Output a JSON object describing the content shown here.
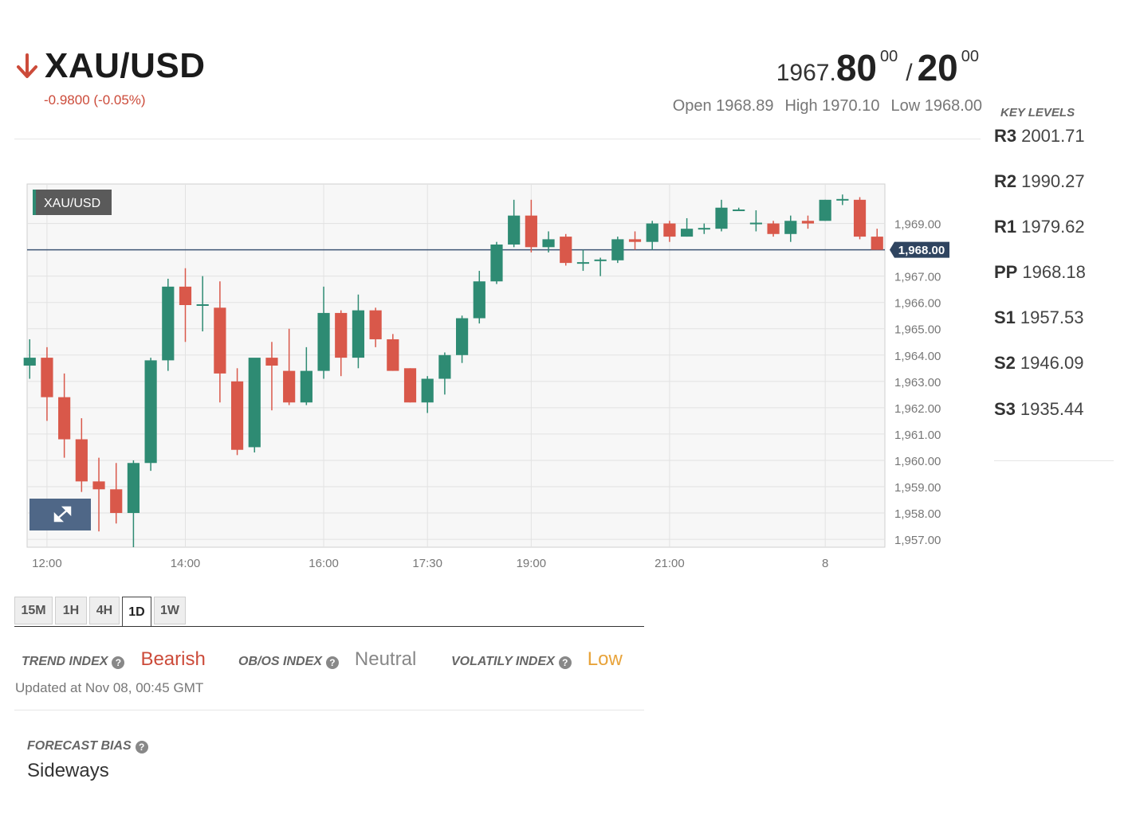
{
  "header": {
    "symbol": "XAU/USD",
    "change": "-0.9800 (-0.05%)",
    "bid_int": "1967.",
    "bid_big": "80",
    "bid_sup": "00",
    "sep": "/",
    "ask_big": "20",
    "ask_sup": "00",
    "open": "Open 1968.89",
    "high": "High 1970.10",
    "low": "Low 1968.00",
    "colors": {
      "down": "#cc4b3a",
      "up": "#2e8b73"
    }
  },
  "key_levels": {
    "title": "KEY LEVELS",
    "items": [
      {
        "name": "R3",
        "value": "2001.71"
      },
      {
        "name": "R2",
        "value": "1990.27"
      },
      {
        "name": "R1",
        "value": "1979.62"
      },
      {
        "name": "PP",
        "value": "1968.18"
      },
      {
        "name": "S1",
        "value": "1957.53"
      },
      {
        "name": "S2",
        "value": "1946.09"
      },
      {
        "name": "S3",
        "value": "1935.44"
      }
    ]
  },
  "chart_data": {
    "type": "candlestick",
    "legend_label": "XAU/USD",
    "current_price": 1968.0,
    "current_price_label": "1,968.00",
    "ylim": [
      1956.7,
      1970.5
    ],
    "y_ticks": [
      1969,
      1967,
      1966,
      1965,
      1964,
      1963,
      1962,
      1961,
      1960,
      1959,
      1958,
      1957
    ],
    "y_tick_labels": [
      "1,969.00",
      "1,967.00",
      "1,966.00",
      "1,965.00",
      "1,964.00",
      "1,963.00",
      "1,962.00",
      "1,961.00",
      "1,960.00",
      "1,959.00",
      "1,958.00",
      "1,957.00"
    ],
    "x_ticks": [
      {
        "index": 1,
        "label": "12:00"
      },
      {
        "index": 9,
        "label": "14:00"
      },
      {
        "index": 17,
        "label": "16:00"
      },
      {
        "index": 23,
        "label": "17:30"
      },
      {
        "index": 29,
        "label": "19:00"
      },
      {
        "index": 37,
        "label": "21:00"
      },
      {
        "index": 46,
        "label": "8"
      }
    ],
    "grid": true,
    "up_color": "#2e8b73",
    "down_color": "#d9584a",
    "candles": [
      {
        "o": 1963.6,
        "h": 1964.6,
        "l": 1963.1,
        "c": 1963.9
      },
      {
        "o": 1963.9,
        "h": 1964.3,
        "l": 1961.5,
        "c": 1962.4
      },
      {
        "o": 1962.4,
        "h": 1963.3,
        "l": 1960.1,
        "c": 1960.8
      },
      {
        "o": 1960.8,
        "h": 1961.6,
        "l": 1958.8,
        "c": 1959.2
      },
      {
        "o": 1959.2,
        "h": 1960.1,
        "l": 1957.3,
        "c": 1958.9
      },
      {
        "o": 1958.9,
        "h": 1959.9,
        "l": 1957.6,
        "c": 1958.0
      },
      {
        "o": 1958.0,
        "h": 1960.0,
        "l": 1956.7,
        "c": 1959.9
      },
      {
        "o": 1959.9,
        "h": 1963.9,
        "l": 1959.6,
        "c": 1963.8
      },
      {
        "o": 1963.8,
        "h": 1966.9,
        "l": 1963.4,
        "c": 1966.6
      },
      {
        "o": 1966.6,
        "h": 1967.3,
        "l": 1964.5,
        "c": 1965.9
      },
      {
        "o": 1965.9,
        "h": 1967.0,
        "l": 1964.9,
        "c": 1965.9
      },
      {
        "o": 1965.8,
        "h": 1966.8,
        "l": 1962.2,
        "c": 1963.3
      },
      {
        "o": 1963.0,
        "h": 1963.5,
        "l": 1960.2,
        "c": 1960.4
      },
      {
        "o": 1960.5,
        "h": 1963.8,
        "l": 1960.3,
        "c": 1963.9
      },
      {
        "o": 1963.9,
        "h": 1964.5,
        "l": 1961.9,
        "c": 1963.6
      },
      {
        "o": 1963.4,
        "h": 1965.0,
        "l": 1962.1,
        "c": 1962.2
      },
      {
        "o": 1962.2,
        "h": 1964.3,
        "l": 1962.1,
        "c": 1963.4
      },
      {
        "o": 1963.4,
        "h": 1966.6,
        "l": 1963.1,
        "c": 1965.6
      },
      {
        "o": 1965.6,
        "h": 1965.7,
        "l": 1963.2,
        "c": 1963.9
      },
      {
        "o": 1963.9,
        "h": 1966.3,
        "l": 1963.5,
        "c": 1965.7
      },
      {
        "o": 1965.7,
        "h": 1965.8,
        "l": 1964.3,
        "c": 1964.6
      },
      {
        "o": 1964.6,
        "h": 1964.8,
        "l": 1963.4,
        "c": 1963.4
      },
      {
        "o": 1963.5,
        "h": 1963.5,
        "l": 1962.2,
        "c": 1962.2
      },
      {
        "o": 1962.2,
        "h": 1963.2,
        "l": 1961.8,
        "c": 1963.1
      },
      {
        "o": 1963.1,
        "h": 1964.1,
        "l": 1962.5,
        "c": 1964.0
      },
      {
        "o": 1964.0,
        "h": 1965.5,
        "l": 1963.7,
        "c": 1965.4
      },
      {
        "o": 1965.4,
        "h": 1967.2,
        "l": 1965.2,
        "c": 1966.8
      },
      {
        "o": 1966.8,
        "h": 1968.3,
        "l": 1966.7,
        "c": 1968.2
      },
      {
        "o": 1968.2,
        "h": 1969.9,
        "l": 1968.1,
        "c": 1969.3
      },
      {
        "o": 1969.3,
        "h": 1969.9,
        "l": 1967.9,
        "c": 1968.1
      },
      {
        "o": 1968.1,
        "h": 1968.7,
        "l": 1967.9,
        "c": 1968.4
      },
      {
        "o": 1968.5,
        "h": 1968.6,
        "l": 1967.4,
        "c": 1967.5
      },
      {
        "o": 1967.5,
        "h": 1968.0,
        "l": 1967.2,
        "c": 1967.5
      },
      {
        "o": 1967.6,
        "h": 1967.7,
        "l": 1967.0,
        "c": 1967.6
      },
      {
        "o": 1967.6,
        "h": 1968.5,
        "l": 1967.5,
        "c": 1968.4
      },
      {
        "o": 1968.4,
        "h": 1968.7,
        "l": 1968.0,
        "c": 1968.3
      },
      {
        "o": 1968.3,
        "h": 1969.1,
        "l": 1968.0,
        "c": 1969.0
      },
      {
        "o": 1969.0,
        "h": 1969.1,
        "l": 1968.3,
        "c": 1968.5
      },
      {
        "o": 1968.5,
        "h": 1969.2,
        "l": 1968.5,
        "c": 1968.8
      },
      {
        "o": 1968.8,
        "h": 1969.0,
        "l": 1968.6,
        "c": 1968.8
      },
      {
        "o": 1968.8,
        "h": 1969.9,
        "l": 1968.7,
        "c": 1969.6
      },
      {
        "o": 1969.5,
        "h": 1969.6,
        "l": 1969.5,
        "c": 1969.5
      },
      {
        "o": 1969.0,
        "h": 1969.5,
        "l": 1968.7,
        "c": 1969.0
      },
      {
        "o": 1969.0,
        "h": 1969.1,
        "l": 1968.5,
        "c": 1968.6
      },
      {
        "o": 1968.6,
        "h": 1969.3,
        "l": 1968.3,
        "c": 1969.1
      },
      {
        "o": 1969.1,
        "h": 1969.3,
        "l": 1968.8,
        "c": 1969.0
      },
      {
        "o": 1969.1,
        "h": 1969.9,
        "l": 1969.1,
        "c": 1969.9
      },
      {
        "o": 1969.9,
        "h": 1970.1,
        "l": 1969.7,
        "c": 1969.9
      },
      {
        "o": 1969.9,
        "h": 1970.0,
        "l": 1968.4,
        "c": 1968.5
      },
      {
        "o": 1968.5,
        "h": 1968.8,
        "l": 1968.0,
        "c": 1968.0
      }
    ]
  },
  "timeframes": {
    "items": [
      "15M",
      "1H",
      "4H",
      "1D",
      "1W"
    ],
    "active": "1D"
  },
  "indexes": {
    "trend_label": "TREND INDEX",
    "trend_value": "Bearish",
    "obos_label": "OB/OS INDEX",
    "obos_value": "Neutral",
    "volatility_label": "VOLATILY INDEX",
    "volatility_value": "Low",
    "colors": {
      "bearish": "#cc4b3a",
      "neutral": "#888888",
      "low": "#e8a33a"
    },
    "updated": "Updated at Nov 08, 00:45 GMT"
  },
  "forecast": {
    "label": "FORECAST BIAS",
    "value": "Sideways"
  },
  "icons": {
    "direction": "arrow-down-icon",
    "help": "question-circle-icon",
    "expand": "expand-icon"
  }
}
